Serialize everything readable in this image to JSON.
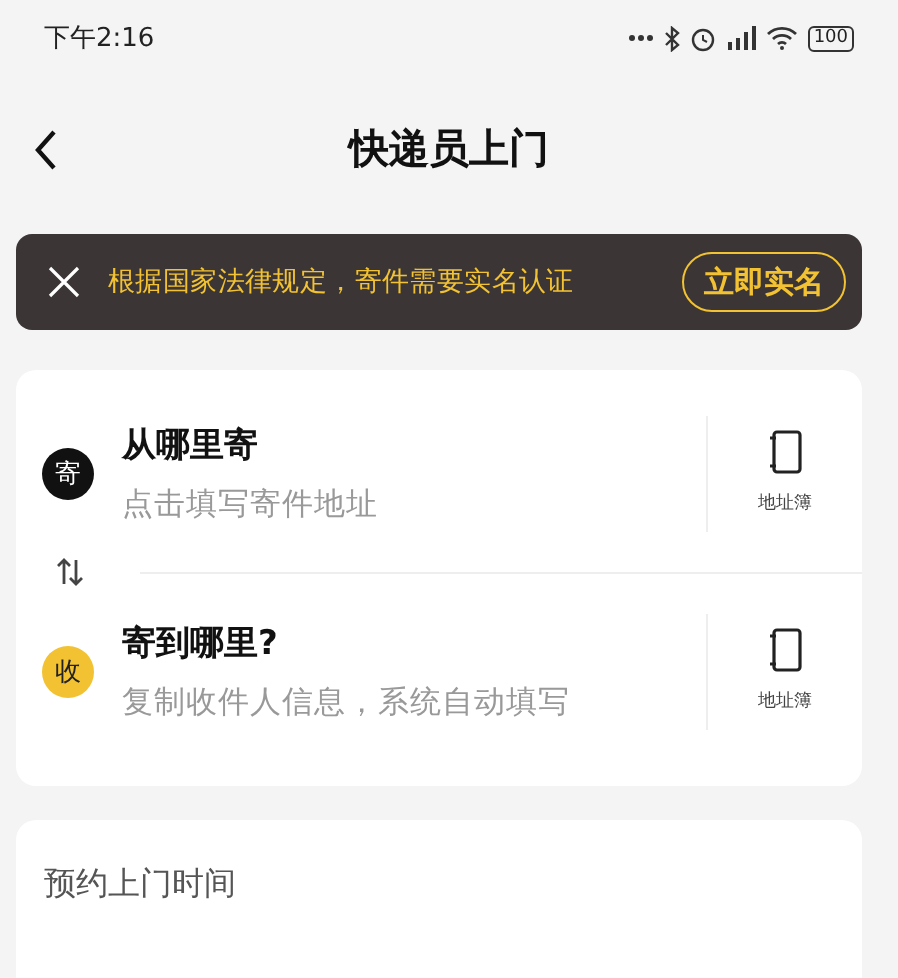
{
  "status_bar": {
    "time": "下午2:16",
    "battery": "100"
  },
  "nav": {
    "title": "快递员上门"
  },
  "notice": {
    "text": "根据国家法律规定，寄件需要实名认证",
    "action": "立即实名"
  },
  "addresses": [
    {
      "kind": "send",
      "badge": "寄",
      "color": "#111111",
      "title": "从哪里寄",
      "hint": "点击填写寄件地址",
      "book": "地址簿"
    },
    {
      "kind": "receive",
      "badge": "收",
      "color": "#f2c232",
      "title": "寄到哪里?",
      "hint": "复制收件人信息，系统自动填写",
      "book": "地址簿"
    }
  ],
  "schedule": {
    "label": "预约上门时间"
  }
}
